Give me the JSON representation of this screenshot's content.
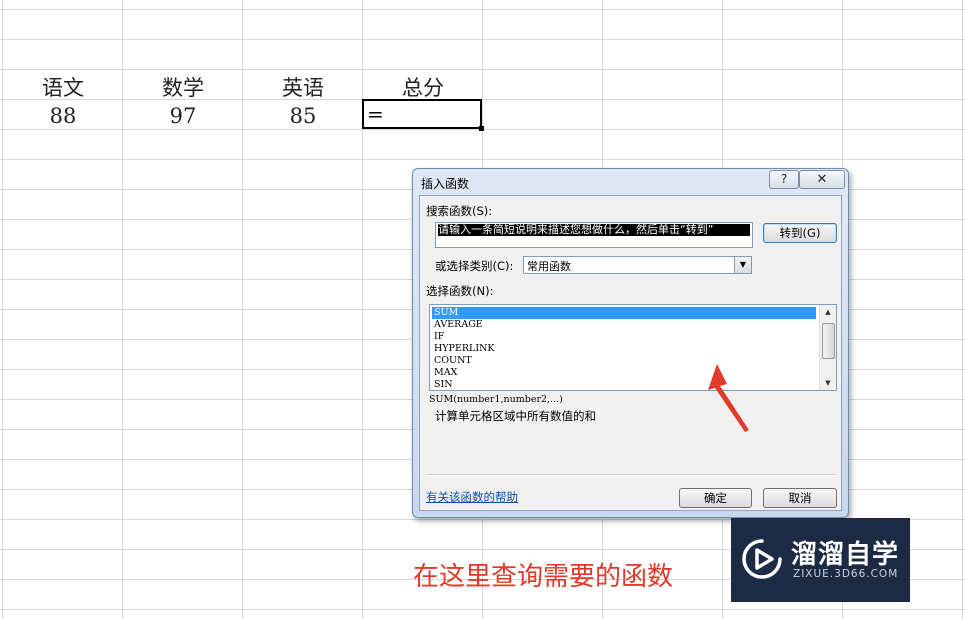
{
  "sheet": {
    "headers": [
      "语文",
      "数学",
      "英语",
      "总分"
    ],
    "values": [
      "88",
      "97",
      "85"
    ],
    "active_cell_value": "="
  },
  "dialog": {
    "title": "插入函数",
    "help_button": "?",
    "close_button": "✕",
    "search_label": "搜索函数(S):",
    "search_value": "请输入一条简短说明来描述您想做什么，然后单击“转到”",
    "goto_button": "转到(G)",
    "category_label": "或选择类别(C):",
    "category_value": "常用函数",
    "function_label": "选择函数(N):",
    "functions": [
      "SUM",
      "AVERAGE",
      "IF",
      "HYPERLINK",
      "COUNT",
      "MAX",
      "SIN"
    ],
    "selected_function": "SUM",
    "syntax": "SUM(number1,number2,...)",
    "description": "计算单元格区域中所有数值的和",
    "help_link": "有关该函数的帮助",
    "ok_button": "确定",
    "cancel_button": "取消"
  },
  "annotation": {
    "caption": "在这里查询需要的函数",
    "arrow_color": "#e03a2a"
  },
  "watermark": {
    "name": "溜溜自学",
    "url": "ZIXUE.3D66.COM",
    "background": "#1c2b43"
  }
}
